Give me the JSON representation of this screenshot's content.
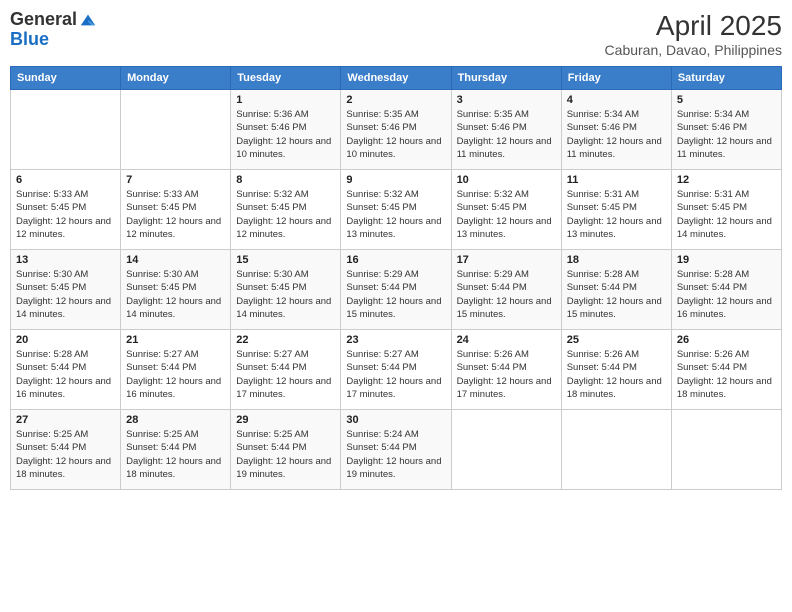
{
  "logo": {
    "line1": "General",
    "line2": "Blue"
  },
  "title": "April 2025",
  "subtitle": "Caburan, Davao, Philippines",
  "days_of_week": [
    "Sunday",
    "Monday",
    "Tuesday",
    "Wednesday",
    "Thursday",
    "Friday",
    "Saturday"
  ],
  "weeks": [
    [
      {
        "day": "",
        "sunrise": "",
        "sunset": "",
        "daylight": ""
      },
      {
        "day": "",
        "sunrise": "",
        "sunset": "",
        "daylight": ""
      },
      {
        "day": "1",
        "sunrise": "Sunrise: 5:36 AM",
        "sunset": "Sunset: 5:46 PM",
        "daylight": "Daylight: 12 hours and 10 minutes."
      },
      {
        "day": "2",
        "sunrise": "Sunrise: 5:35 AM",
        "sunset": "Sunset: 5:46 PM",
        "daylight": "Daylight: 12 hours and 10 minutes."
      },
      {
        "day": "3",
        "sunrise": "Sunrise: 5:35 AM",
        "sunset": "Sunset: 5:46 PM",
        "daylight": "Daylight: 12 hours and 11 minutes."
      },
      {
        "day": "4",
        "sunrise": "Sunrise: 5:34 AM",
        "sunset": "Sunset: 5:46 PM",
        "daylight": "Daylight: 12 hours and 11 minutes."
      },
      {
        "day": "5",
        "sunrise": "Sunrise: 5:34 AM",
        "sunset": "Sunset: 5:46 PM",
        "daylight": "Daylight: 12 hours and 11 minutes."
      }
    ],
    [
      {
        "day": "6",
        "sunrise": "Sunrise: 5:33 AM",
        "sunset": "Sunset: 5:45 PM",
        "daylight": "Daylight: 12 hours and 12 minutes."
      },
      {
        "day": "7",
        "sunrise": "Sunrise: 5:33 AM",
        "sunset": "Sunset: 5:45 PM",
        "daylight": "Daylight: 12 hours and 12 minutes."
      },
      {
        "day": "8",
        "sunrise": "Sunrise: 5:32 AM",
        "sunset": "Sunset: 5:45 PM",
        "daylight": "Daylight: 12 hours and 12 minutes."
      },
      {
        "day": "9",
        "sunrise": "Sunrise: 5:32 AM",
        "sunset": "Sunset: 5:45 PM",
        "daylight": "Daylight: 12 hours and 13 minutes."
      },
      {
        "day": "10",
        "sunrise": "Sunrise: 5:32 AM",
        "sunset": "Sunset: 5:45 PM",
        "daylight": "Daylight: 12 hours and 13 minutes."
      },
      {
        "day": "11",
        "sunrise": "Sunrise: 5:31 AM",
        "sunset": "Sunset: 5:45 PM",
        "daylight": "Daylight: 12 hours and 13 minutes."
      },
      {
        "day": "12",
        "sunrise": "Sunrise: 5:31 AM",
        "sunset": "Sunset: 5:45 PM",
        "daylight": "Daylight: 12 hours and 14 minutes."
      }
    ],
    [
      {
        "day": "13",
        "sunrise": "Sunrise: 5:30 AM",
        "sunset": "Sunset: 5:45 PM",
        "daylight": "Daylight: 12 hours and 14 minutes."
      },
      {
        "day": "14",
        "sunrise": "Sunrise: 5:30 AM",
        "sunset": "Sunset: 5:45 PM",
        "daylight": "Daylight: 12 hours and 14 minutes."
      },
      {
        "day": "15",
        "sunrise": "Sunrise: 5:30 AM",
        "sunset": "Sunset: 5:45 PM",
        "daylight": "Daylight: 12 hours and 14 minutes."
      },
      {
        "day": "16",
        "sunrise": "Sunrise: 5:29 AM",
        "sunset": "Sunset: 5:44 PM",
        "daylight": "Daylight: 12 hours and 15 minutes."
      },
      {
        "day": "17",
        "sunrise": "Sunrise: 5:29 AM",
        "sunset": "Sunset: 5:44 PM",
        "daylight": "Daylight: 12 hours and 15 minutes."
      },
      {
        "day": "18",
        "sunrise": "Sunrise: 5:28 AM",
        "sunset": "Sunset: 5:44 PM",
        "daylight": "Daylight: 12 hours and 15 minutes."
      },
      {
        "day": "19",
        "sunrise": "Sunrise: 5:28 AM",
        "sunset": "Sunset: 5:44 PM",
        "daylight": "Daylight: 12 hours and 16 minutes."
      }
    ],
    [
      {
        "day": "20",
        "sunrise": "Sunrise: 5:28 AM",
        "sunset": "Sunset: 5:44 PM",
        "daylight": "Daylight: 12 hours and 16 minutes."
      },
      {
        "day": "21",
        "sunrise": "Sunrise: 5:27 AM",
        "sunset": "Sunset: 5:44 PM",
        "daylight": "Daylight: 12 hours and 16 minutes."
      },
      {
        "day": "22",
        "sunrise": "Sunrise: 5:27 AM",
        "sunset": "Sunset: 5:44 PM",
        "daylight": "Daylight: 12 hours and 17 minutes."
      },
      {
        "day": "23",
        "sunrise": "Sunrise: 5:27 AM",
        "sunset": "Sunset: 5:44 PM",
        "daylight": "Daylight: 12 hours and 17 minutes."
      },
      {
        "day": "24",
        "sunrise": "Sunrise: 5:26 AM",
        "sunset": "Sunset: 5:44 PM",
        "daylight": "Daylight: 12 hours and 17 minutes."
      },
      {
        "day": "25",
        "sunrise": "Sunrise: 5:26 AM",
        "sunset": "Sunset: 5:44 PM",
        "daylight": "Daylight: 12 hours and 18 minutes."
      },
      {
        "day": "26",
        "sunrise": "Sunrise: 5:26 AM",
        "sunset": "Sunset: 5:44 PM",
        "daylight": "Daylight: 12 hours and 18 minutes."
      }
    ],
    [
      {
        "day": "27",
        "sunrise": "Sunrise: 5:25 AM",
        "sunset": "Sunset: 5:44 PM",
        "daylight": "Daylight: 12 hours and 18 minutes."
      },
      {
        "day": "28",
        "sunrise": "Sunrise: 5:25 AM",
        "sunset": "Sunset: 5:44 PM",
        "daylight": "Daylight: 12 hours and 18 minutes."
      },
      {
        "day": "29",
        "sunrise": "Sunrise: 5:25 AM",
        "sunset": "Sunset: 5:44 PM",
        "daylight": "Daylight: 12 hours and 19 minutes."
      },
      {
        "day": "30",
        "sunrise": "Sunrise: 5:24 AM",
        "sunset": "Sunset: 5:44 PM",
        "daylight": "Daylight: 12 hours and 19 minutes."
      },
      {
        "day": "",
        "sunrise": "",
        "sunset": "",
        "daylight": ""
      },
      {
        "day": "",
        "sunrise": "",
        "sunset": "",
        "daylight": ""
      },
      {
        "day": "",
        "sunrise": "",
        "sunset": "",
        "daylight": ""
      }
    ]
  ]
}
